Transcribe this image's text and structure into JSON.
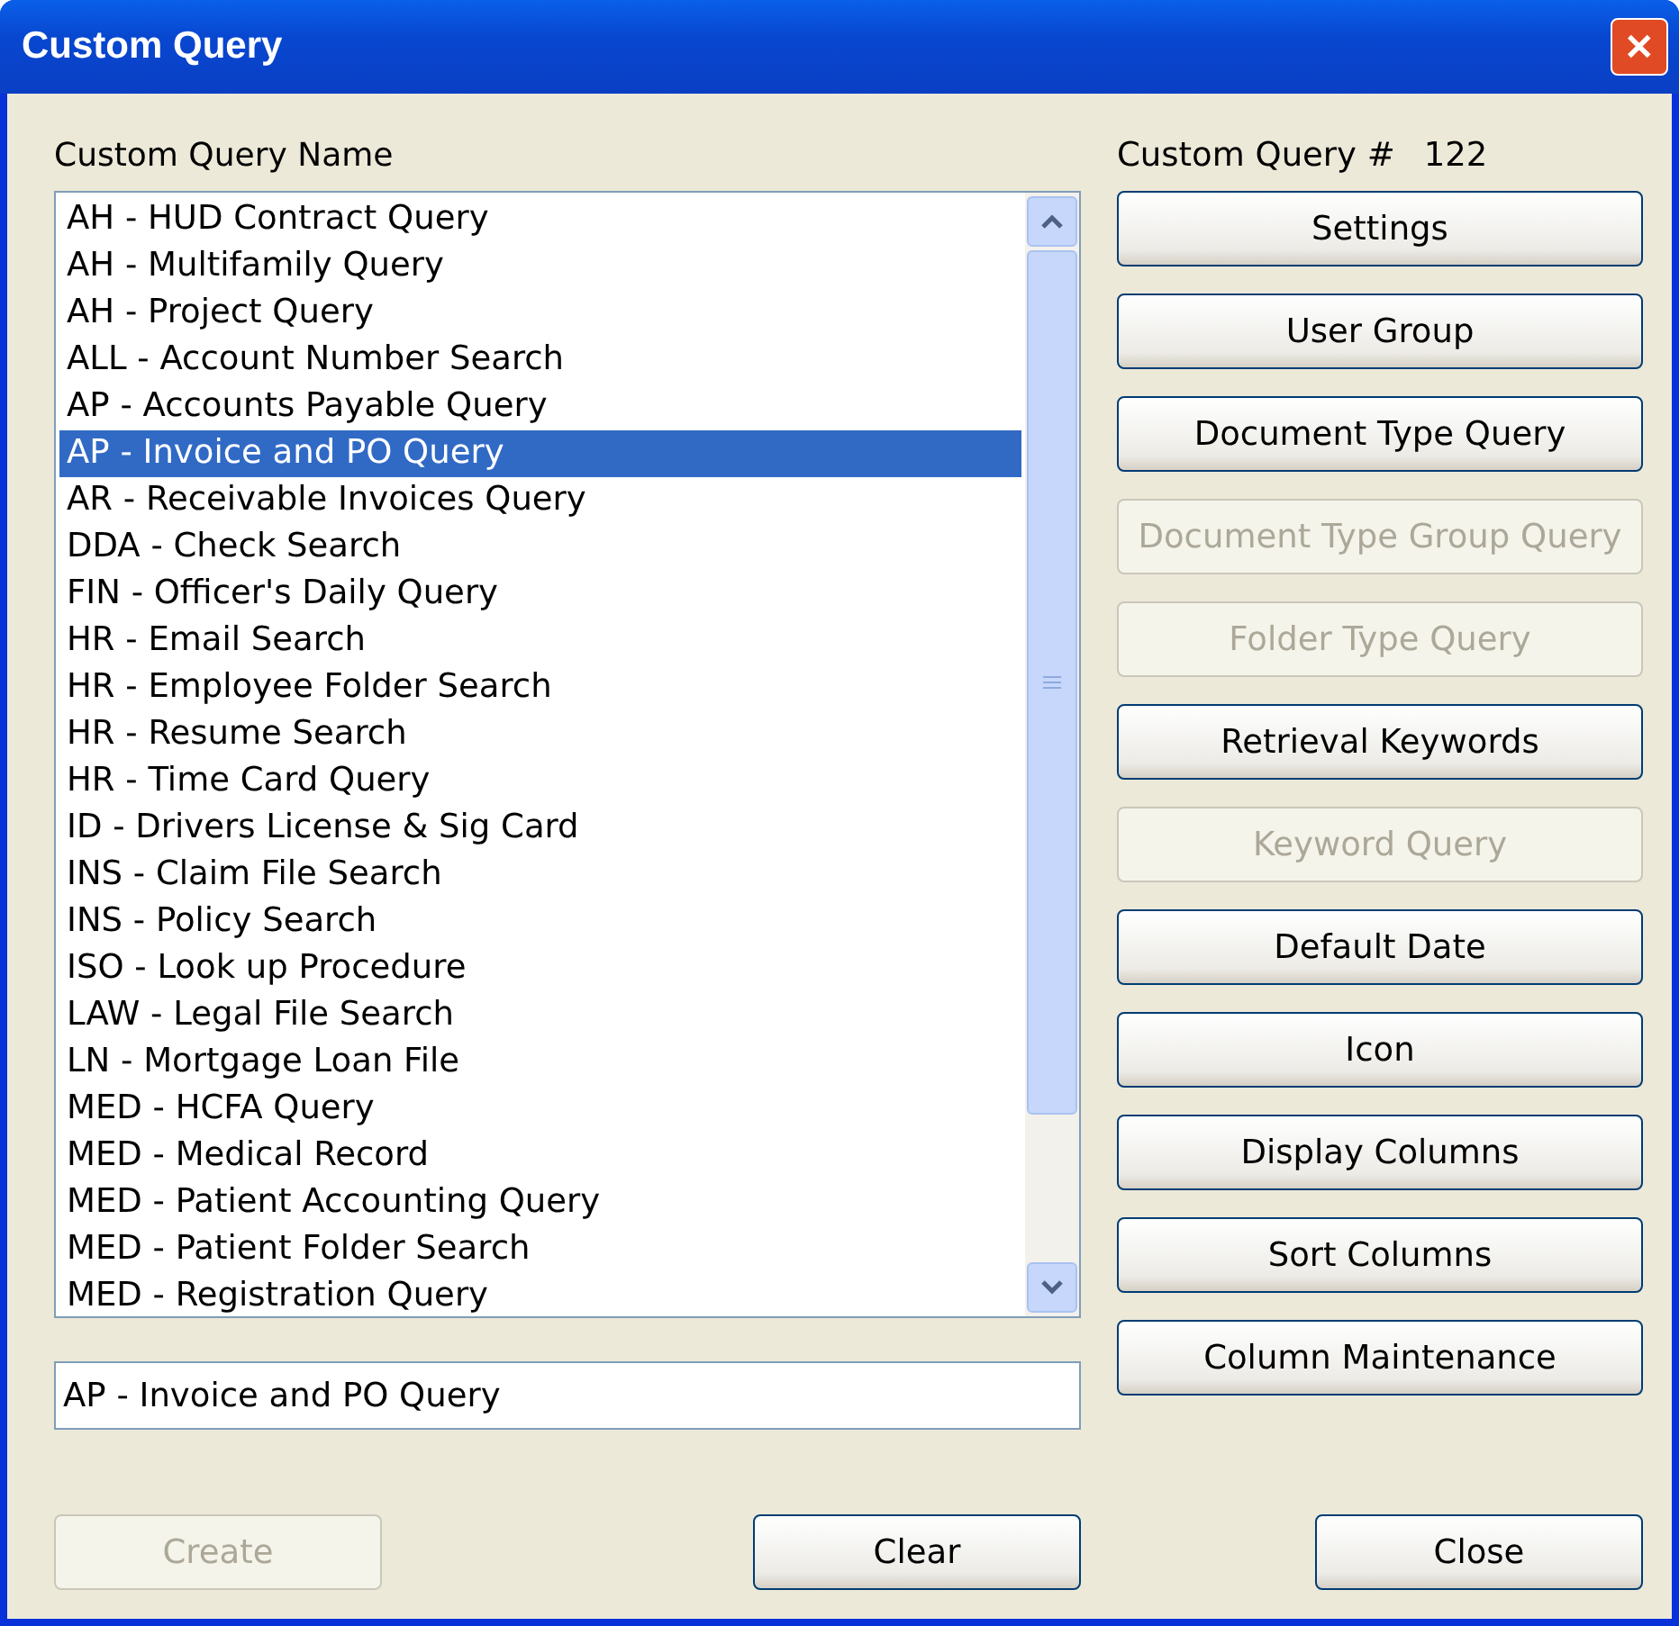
{
  "window": {
    "title": "Custom Query",
    "close": "✕"
  },
  "list_label": "Custom Query Name",
  "query_number_label": "Custom Query #",
  "query_number": "122",
  "queries": [
    {
      "label": "AH - HUD Contract Query",
      "selected": false
    },
    {
      "label": "AH - Multifamily Query",
      "selected": false
    },
    {
      "label": "AH - Project Query",
      "selected": false
    },
    {
      "label": "ALL - Account Number Search",
      "selected": false
    },
    {
      "label": "AP - Accounts Payable Query",
      "selected": false
    },
    {
      "label": "AP - Invoice and PO Query",
      "selected": true
    },
    {
      "label": "AR - Receivable Invoices Query",
      "selected": false
    },
    {
      "label": "DDA - Check Search",
      "selected": false
    },
    {
      "label": "FIN - Officer's Daily Query",
      "selected": false
    },
    {
      "label": "HR - Email Search",
      "selected": false
    },
    {
      "label": "HR - Employee Folder Search",
      "selected": false
    },
    {
      "label": "HR - Resume Search",
      "selected": false
    },
    {
      "label": "HR - Time Card Query",
      "selected": false
    },
    {
      "label": "ID - Drivers License & Sig Card",
      "selected": false
    },
    {
      "label": "INS - Claim File Search",
      "selected": false
    },
    {
      "label": "INS - Policy Search",
      "selected": false
    },
    {
      "label": "ISO - Look up Procedure",
      "selected": false
    },
    {
      "label": "LAW - Legal File Search",
      "selected": false
    },
    {
      "label": "LN - Mortgage Loan File",
      "selected": false
    },
    {
      "label": "MED - HCFA Query",
      "selected": false
    },
    {
      "label": "MED - Medical Record",
      "selected": false
    },
    {
      "label": "MED - Patient Accounting Query",
      "selected": false
    },
    {
      "label": "MED - Patient Folder Search",
      "selected": false
    },
    {
      "label": "MED - Registration Query",
      "selected": false
    }
  ],
  "name_field": {
    "value": "AP - Invoice and PO Query"
  },
  "side_buttons": [
    {
      "label": "Settings",
      "disabled": false
    },
    {
      "label": "User Group",
      "disabled": false
    },
    {
      "label": "Document Type Query",
      "disabled": false
    },
    {
      "label": "Document Type Group Query",
      "disabled": true
    },
    {
      "label": "Folder Type Query",
      "disabled": true
    },
    {
      "label": "Retrieval Keywords",
      "disabled": false
    },
    {
      "label": "Keyword Query",
      "disabled": true
    },
    {
      "label": "Default Date",
      "disabled": false
    },
    {
      "label": "Icon",
      "disabled": false
    },
    {
      "label": "Display Columns",
      "disabled": false
    },
    {
      "label": "Sort Columns",
      "disabled": false
    },
    {
      "label": "Column Maintenance",
      "disabled": false
    }
  ],
  "bottom_buttons": [
    {
      "label": "Create",
      "disabled": true
    },
    {
      "label": "Clear",
      "disabled": false
    },
    {
      "label": "Close",
      "disabled": false
    }
  ]
}
